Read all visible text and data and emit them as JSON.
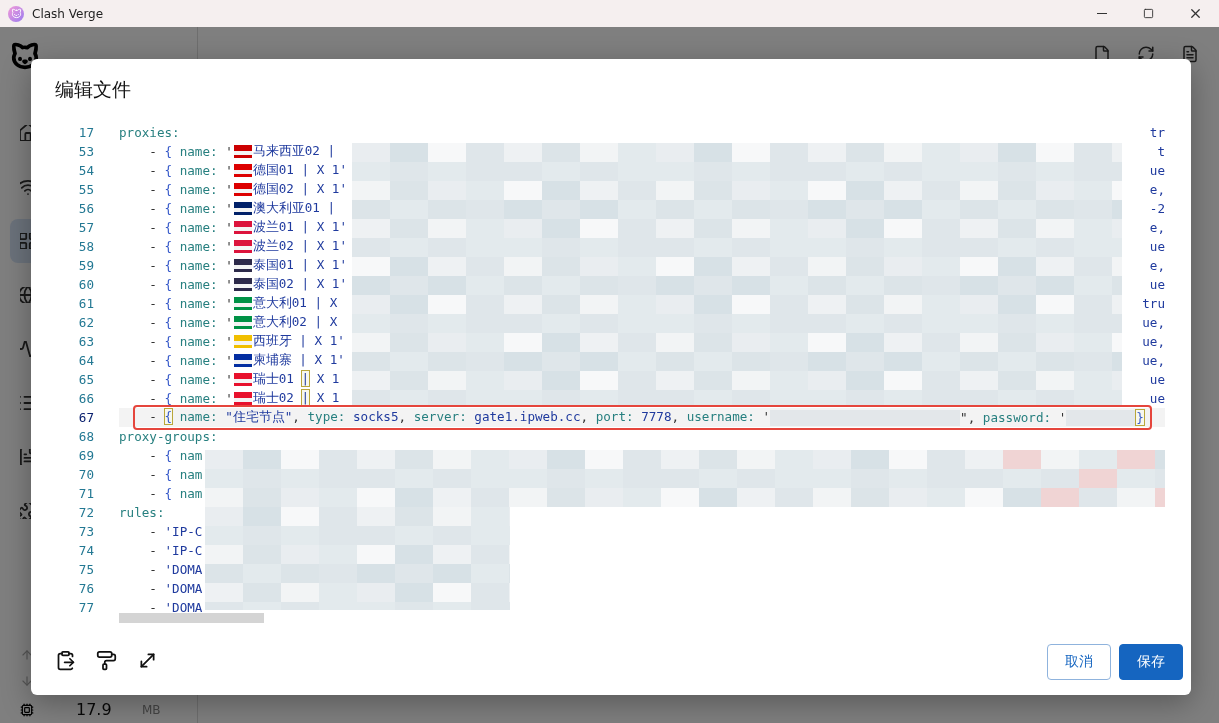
{
  "window": {
    "title": "Clash Verge"
  },
  "sidebar": {
    "items": [
      {
        "selected": false
      },
      {
        "selected": false
      },
      {
        "selected": true
      },
      {
        "selected": false
      },
      {
        "selected": false
      },
      {
        "selected": false
      },
      {
        "selected": false
      },
      {
        "selected": false
      }
    ]
  },
  "status": {
    "memory": "17.9",
    "unit": "MB"
  },
  "dialog": {
    "title": "编辑文件",
    "lines": [
      {
        "number": "17",
        "selected": false,
        "tail": "tr",
        "tokens": [
          {
            "text": "proxies:",
            "kind": "key"
          }
        ]
      },
      {
        "number": "53",
        "selected": false,
        "tail": "t",
        "tokens": [
          {
            "text": "    - ",
            "kind": "plain"
          },
          {
            "text": "{",
            "kind": "brace"
          },
          {
            "text": " name:",
            "kind": "key"
          },
          {
            "text": " '",
            "kind": "plain"
          },
          {
            "kind": "flag",
            "color": "#cc0001"
          },
          {
            "text": "马来西亚02 |",
            "kind": "string"
          }
        ]
      },
      {
        "number": "54",
        "selected": false,
        "tail": "ue",
        "tokens": [
          {
            "text": "    - ",
            "kind": "plain"
          },
          {
            "text": "{",
            "kind": "brace"
          },
          {
            "text": " name:",
            "kind": "key"
          },
          {
            "text": " '",
            "kind": "plain"
          },
          {
            "kind": "flag",
            "color": "#dd0000"
          },
          {
            "text": "德国01 | X 1'",
            "kind": "string"
          }
        ]
      },
      {
        "number": "55",
        "selected": false,
        "tail": "e,",
        "tokens": [
          {
            "text": "    - ",
            "kind": "plain"
          },
          {
            "text": "{",
            "kind": "brace"
          },
          {
            "text": " name:",
            "kind": "key"
          },
          {
            "text": " '",
            "kind": "plain"
          },
          {
            "kind": "flag",
            "color": "#dd0000"
          },
          {
            "text": "德国02 | X 1'",
            "kind": "string"
          }
        ]
      },
      {
        "number": "56",
        "selected": false,
        "tail": "-2",
        "tokens": [
          {
            "text": "    - ",
            "kind": "plain"
          },
          {
            "text": "{",
            "kind": "brace"
          },
          {
            "text": " name:",
            "kind": "key"
          },
          {
            "text": " '",
            "kind": "plain"
          },
          {
            "kind": "flag",
            "color": "#012169"
          },
          {
            "text": "澳大利亚01 |",
            "kind": "string"
          }
        ]
      },
      {
        "number": "57",
        "selected": false,
        "tail": "e,",
        "tokens": [
          {
            "text": "    - ",
            "kind": "plain"
          },
          {
            "text": "{",
            "kind": "brace"
          },
          {
            "text": " name:",
            "kind": "key"
          },
          {
            "text": " '",
            "kind": "plain"
          },
          {
            "kind": "flag",
            "color": "#dc143c"
          },
          {
            "text": "波兰01 | X 1'",
            "kind": "string"
          }
        ]
      },
      {
        "number": "58",
        "selected": false,
        "tail": "ue",
        "tokens": [
          {
            "text": "    - ",
            "kind": "plain"
          },
          {
            "text": "{",
            "kind": "brace"
          },
          {
            "text": " name:",
            "kind": "key"
          },
          {
            "text": " '",
            "kind": "plain"
          },
          {
            "kind": "flag",
            "color": "#dc143c"
          },
          {
            "text": "波兰02 | X 1'",
            "kind": "string"
          }
        ]
      },
      {
        "number": "59",
        "selected": false,
        "tail": "e,",
        "tokens": [
          {
            "text": "    - ",
            "kind": "plain"
          },
          {
            "text": "{",
            "kind": "brace"
          },
          {
            "text": " name:",
            "kind": "key"
          },
          {
            "text": " '",
            "kind": "plain"
          },
          {
            "kind": "flag",
            "color": "#2d2a4a"
          },
          {
            "text": "泰国01 | X 1'",
            "kind": "string"
          }
        ]
      },
      {
        "number": "60",
        "selected": false,
        "tail": "ue",
        "tokens": [
          {
            "text": "    - ",
            "kind": "plain"
          },
          {
            "text": "{",
            "kind": "brace"
          },
          {
            "text": " name:",
            "kind": "key"
          },
          {
            "text": " '",
            "kind": "plain"
          },
          {
            "kind": "flag",
            "color": "#2d2a4a"
          },
          {
            "text": "泰国02 | X 1'",
            "kind": "string"
          }
        ]
      },
      {
        "number": "61",
        "selected": false,
        "tail": "tru",
        "tokens": [
          {
            "text": "    - ",
            "kind": "plain"
          },
          {
            "text": "{",
            "kind": "brace"
          },
          {
            "text": " name:",
            "kind": "key"
          },
          {
            "text": " '",
            "kind": "plain"
          },
          {
            "kind": "flag",
            "color": "#009246"
          },
          {
            "text": "意大利01 | X",
            "kind": "string"
          }
        ]
      },
      {
        "number": "62",
        "selected": false,
        "tail": "ue,",
        "tokens": [
          {
            "text": "    - ",
            "kind": "plain"
          },
          {
            "text": "{",
            "kind": "brace"
          },
          {
            "text": " name:",
            "kind": "key"
          },
          {
            "text": " '",
            "kind": "plain"
          },
          {
            "kind": "flag",
            "color": "#009246"
          },
          {
            "text": "意大利02 | X",
            "kind": "string"
          }
        ]
      },
      {
        "number": "63",
        "selected": false,
        "tail": "ue,",
        "tokens": [
          {
            "text": "    - ",
            "kind": "plain"
          },
          {
            "text": "{",
            "kind": "brace"
          },
          {
            "text": " name:",
            "kind": "key"
          },
          {
            "text": " '",
            "kind": "plain"
          },
          {
            "kind": "flag",
            "color": "#f1bf00"
          },
          {
            "text": "西班牙 | X 1'",
            "kind": "string"
          }
        ]
      },
      {
        "number": "64",
        "selected": false,
        "tail": "ue,",
        "tokens": [
          {
            "text": "    - ",
            "kind": "plain"
          },
          {
            "text": "{",
            "kind": "brace"
          },
          {
            "text": " name:",
            "kind": "key"
          },
          {
            "text": " '",
            "kind": "plain"
          },
          {
            "kind": "flag",
            "color": "#032ea1"
          },
          {
            "text": "柬埔寨 | X 1'",
            "kind": "string"
          }
        ]
      },
      {
        "number": "65",
        "selected": false,
        "tail": "ue",
        "tokens": [
          {
            "text": "    - ",
            "kind": "plain"
          },
          {
            "text": "{",
            "kind": "brace"
          },
          {
            "text": " name:",
            "kind": "key"
          },
          {
            "text": " '",
            "kind": "plain"
          },
          {
            "kind": "flag",
            "color": "#e8112d"
          },
          {
            "text": "瑞士01 ",
            "kind": "string"
          },
          {
            "text": "|",
            "kind": "string",
            "boxed": true
          },
          {
            "text": " X 1",
            "kind": "string"
          }
        ]
      },
      {
        "number": "66",
        "selected": false,
        "tail": "ue",
        "tokens": [
          {
            "text": "    - ",
            "kind": "plain"
          },
          {
            "text": "{",
            "kind": "brace"
          },
          {
            "text": " name:",
            "kind": "key"
          },
          {
            "text": " '",
            "kind": "plain"
          },
          {
            "kind": "flag",
            "color": "#e8112d"
          },
          {
            "text": "瑞士02 ",
            "kind": "string"
          },
          {
            "text": "|",
            "kind": "string",
            "boxed": true
          },
          {
            "text": " X 1",
            "kind": "string"
          }
        ]
      },
      {
        "number": "67",
        "selected": true,
        "framed": true,
        "tokens": [
          {
            "text": "    - ",
            "kind": "plain"
          },
          {
            "text": "{",
            "kind": "brace",
            "boxed": true
          },
          {
            "text": " name:",
            "kind": "key"
          },
          {
            "text": " \"住宅节点\"",
            "kind": "string"
          },
          {
            "text": ", ",
            "kind": "plain"
          },
          {
            "text": "type:",
            "kind": "key"
          },
          {
            "text": " socks5",
            "kind": "string"
          },
          {
            "text": ", ",
            "kind": "plain"
          },
          {
            "text": "server:",
            "kind": "key"
          },
          {
            "text": " gate1.ipweb.cc",
            "kind": "string"
          },
          {
            "text": ", ",
            "kind": "plain"
          },
          {
            "text": "port:",
            "kind": "key"
          },
          {
            "text": " 7778",
            "kind": "string"
          },
          {
            "text": ", ",
            "kind": "plain"
          },
          {
            "text": "username:",
            "kind": "key"
          },
          {
            "text": " '",
            "kind": "plain"
          },
          {
            "kind": "longmask"
          },
          {
            "text": "\", ",
            "kind": "plain"
          },
          {
            "text": "password:",
            "kind": "key"
          },
          {
            "text": " '",
            "kind": "plain"
          },
          {
            "kind": "shortmask"
          },
          {
            "text": "}",
            "kind": "brace",
            "boxed": true
          }
        ]
      },
      {
        "number": "68",
        "selected": false,
        "tokens": [
          {
            "text": "proxy-groups:",
            "kind": "key"
          }
        ]
      },
      {
        "number": "69",
        "selected": false,
        "tokens": [
          {
            "text": "    - ",
            "kind": "plain"
          },
          {
            "text": "{",
            "kind": "brace"
          },
          {
            "text": " nam",
            "kind": "key"
          }
        ]
      },
      {
        "number": "70",
        "selected": false,
        "tokens": [
          {
            "text": "    - ",
            "kind": "plain"
          },
          {
            "text": "{",
            "kind": "brace"
          },
          {
            "text": " nam",
            "kind": "key"
          }
        ]
      },
      {
        "number": "71",
        "selected": false,
        "tokens": [
          {
            "text": "    - ",
            "kind": "plain"
          },
          {
            "text": "{",
            "kind": "brace"
          },
          {
            "text": " nam",
            "kind": "key"
          }
        ]
      },
      {
        "number": "72",
        "selected": false,
        "tokens": [
          {
            "text": "rules:",
            "kind": "key"
          }
        ]
      },
      {
        "number": "73",
        "selected": false,
        "tokens": [
          {
            "text": "    - ",
            "kind": "plain"
          },
          {
            "text": "'IP-C",
            "kind": "string"
          }
        ]
      },
      {
        "number": "74",
        "selected": false,
        "tokens": [
          {
            "text": "    - ",
            "kind": "plain"
          },
          {
            "text": "'IP-C",
            "kind": "string"
          }
        ]
      },
      {
        "number": "75",
        "selected": false,
        "tokens": [
          {
            "text": "    - ",
            "kind": "plain"
          },
          {
            "text": "'DOMA",
            "kind": "string"
          }
        ]
      },
      {
        "number": "76",
        "selected": false,
        "tokens": [
          {
            "text": "    - ",
            "kind": "plain"
          },
          {
            "text": "'DOMA",
            "kind": "string"
          }
        ]
      },
      {
        "number": "77",
        "selected": false,
        "tokens": [
          {
            "text": "    - ",
            "kind": "plain"
          },
          {
            "text": "'DOMA",
            "kind": "string"
          }
        ]
      }
    ],
    "buttons": [
      {
        "label": "取消",
        "kind": "outlined"
      },
      {
        "label": "保存",
        "kind": "primary"
      }
    ]
  }
}
